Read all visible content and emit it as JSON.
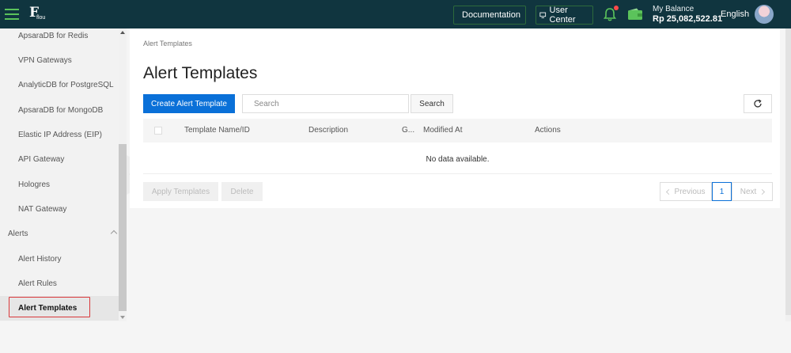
{
  "topbar": {
    "logo_text": "flou",
    "documentation_label": "Documentation",
    "user_center_label": "User Center",
    "balance_label": "My Balance",
    "balance_amount": "Rp 25,082,522.81",
    "language": "English"
  },
  "sidebar": {
    "items": [
      {
        "label": "ApsaraDB for Redis",
        "type": "sub"
      },
      {
        "label": "VPN Gateways",
        "type": "sub"
      },
      {
        "label": "AnalyticDB for PostgreSQL",
        "type": "sub"
      },
      {
        "label": "ApsaraDB for MongoDB",
        "type": "sub"
      },
      {
        "label": "Elastic IP Address (EIP)",
        "type": "sub"
      },
      {
        "label": "API Gateway",
        "type": "sub"
      },
      {
        "label": "Hologres",
        "type": "sub"
      },
      {
        "label": "NAT Gateway",
        "type": "sub"
      },
      {
        "label": "Alerts",
        "type": "group"
      },
      {
        "label": "Alert History",
        "type": "sub"
      },
      {
        "label": "Alert Rules",
        "type": "sub"
      },
      {
        "label": "Alert Templates",
        "type": "sub",
        "active": true
      }
    ]
  },
  "main": {
    "breadcrumb": "Alert Templates",
    "title": "Alert Templates",
    "create_button": "Create Alert Template",
    "search_placeholder": "Search",
    "search_button": "Search",
    "columns": [
      "Template Name/ID",
      "Description",
      "G...",
      "Modified At",
      "Actions"
    ],
    "empty_text": "No data available.",
    "apply_button": "Apply Templates",
    "delete_button": "Delete",
    "pagination": {
      "previous": "Previous",
      "current_page": "1",
      "next": "Next"
    }
  },
  "colors": {
    "topbar_bg": "#10353f",
    "primary": "#0a70d8",
    "highlight_border": "#d9383a",
    "accent_green": "#5bc35b"
  }
}
